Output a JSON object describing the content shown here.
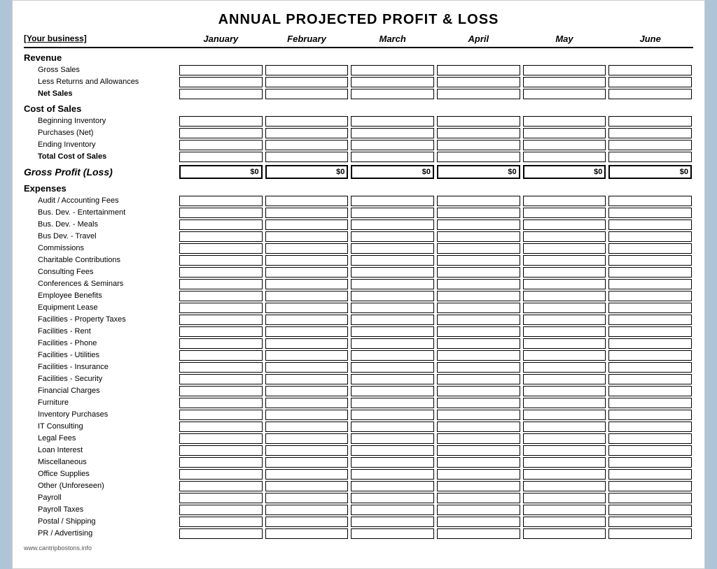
{
  "title": "ANNUAL PROJECTED PROFIT & LOSS",
  "header": {
    "business_label": "[Your business]",
    "months": [
      "January",
      "February",
      "March",
      "April",
      "May",
      "June"
    ]
  },
  "sections": {
    "revenue": {
      "label": "Revenue",
      "rows": [
        {
          "label": "Gross Sales",
          "bold": false
        },
        {
          "label": "Less Returns and Allowances",
          "bold": false
        },
        {
          "label": "Net Sales",
          "bold": true
        }
      ]
    },
    "cost_of_sales": {
      "label": "Cost of Sales",
      "rows": [
        {
          "label": "Beginning Inventory",
          "bold": false
        },
        {
          "label": "Purchases (Net)",
          "bold": false
        },
        {
          "label": "Ending Inventory",
          "bold": false
        },
        {
          "label": "Total Cost of Sales",
          "bold": true
        }
      ]
    },
    "gross_profit": {
      "label": "Gross Profit (Loss)",
      "values": [
        "$0",
        "$0",
        "$0",
        "$0",
        "$0",
        "$0"
      ]
    },
    "expenses": {
      "label": "Expenses",
      "rows": [
        {
          "label": "Audit / Accounting Fees",
          "bold": false
        },
        {
          "label": "Bus. Dev. - Entertainment",
          "bold": false
        },
        {
          "label": "Bus. Dev. - Meals",
          "bold": false
        },
        {
          "label": "Bus Dev. - Travel",
          "bold": false
        },
        {
          "label": "Commissions",
          "bold": false
        },
        {
          "label": "Charitable Contributions",
          "bold": false
        },
        {
          "label": "Consulting Fees",
          "bold": false
        },
        {
          "label": "Conferences & Seminars",
          "bold": false
        },
        {
          "label": "Employee Benefits",
          "bold": false
        },
        {
          "label": "Equipment Lease",
          "bold": false
        },
        {
          "label": "Facilities - Property Taxes",
          "bold": false
        },
        {
          "label": "Facilities - Rent",
          "bold": false
        },
        {
          "label": "Facilities - Phone",
          "bold": false
        },
        {
          "label": "Facilities - Utilities",
          "bold": false
        },
        {
          "label": "Facilities - Insurance",
          "bold": false
        },
        {
          "label": "Facilities - Security",
          "bold": false
        },
        {
          "label": "Financial Charges",
          "bold": false
        },
        {
          "label": "Furniture",
          "bold": false
        },
        {
          "label": "Inventory Purchases",
          "bold": false
        },
        {
          "label": "IT Consulting",
          "bold": false
        },
        {
          "label": "Legal Fees",
          "bold": false
        },
        {
          "label": "Loan Interest",
          "bold": false
        },
        {
          "label": "Miscellaneous",
          "bold": false
        },
        {
          "label": "Office Supplies",
          "bold": false
        },
        {
          "label": "Other (Unforeseen)",
          "bold": false
        },
        {
          "label": "Payroll",
          "bold": false
        },
        {
          "label": "Payroll Taxes",
          "bold": false
        },
        {
          "label": "Postal / Shipping",
          "bold": false
        },
        {
          "label": "PR / Advertising",
          "bold": false
        }
      ]
    }
  },
  "footer": {
    "url": "www.cantripbostons.info"
  }
}
